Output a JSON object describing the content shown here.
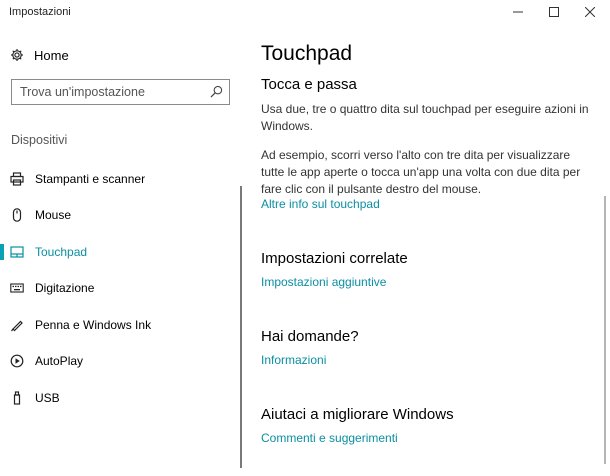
{
  "window": {
    "title": "Impostazioni",
    "controls": {
      "minimize": "minimize-icon",
      "maximize": "maximize-icon",
      "close": "close-icon"
    }
  },
  "sidebar": {
    "home_label": "Home",
    "search_placeholder": "Trova un'impostazione",
    "section_label": "Dispositivi",
    "items": [
      {
        "label": "Stampanti e scanner",
        "icon": "printer-icon",
        "selected": false
      },
      {
        "label": "Mouse",
        "icon": "mouse-icon",
        "selected": false
      },
      {
        "label": "Touchpad",
        "icon": "touchpad-icon",
        "selected": true
      },
      {
        "label": "Digitazione",
        "icon": "keyboard-icon",
        "selected": false
      },
      {
        "label": "Penna e Windows Ink",
        "icon": "pen-icon",
        "selected": false
      },
      {
        "label": "AutoPlay",
        "icon": "autoplay-icon",
        "selected": false
      },
      {
        "label": "USB",
        "icon": "usb-icon",
        "selected": false
      }
    ]
  },
  "content": {
    "title": "Touchpad",
    "tap": {
      "heading": "Tocca e passa",
      "para1": "Usa due, tre o quattro dita sul touchpad per eseguire azioni in Windows.",
      "para2": "Ad esempio, scorri verso l'alto con tre dita per visualizzare tutte le app aperte o tocca un'app una volta con due dita per fare clic con il pulsante destro del mouse.",
      "link": "Altre info sul touchpad"
    },
    "related": {
      "heading": "Impostazioni correlate",
      "link": "Impostazioni aggiuntive"
    },
    "questions": {
      "heading": "Hai domande?",
      "link": "Informazioni"
    },
    "improve": {
      "heading": "Aiutaci a migliorare Windows",
      "link": "Commenti e suggerimenti"
    }
  },
  "colors": {
    "accent": "#0a8fa3",
    "selection_bar": "#0aa1b5"
  }
}
